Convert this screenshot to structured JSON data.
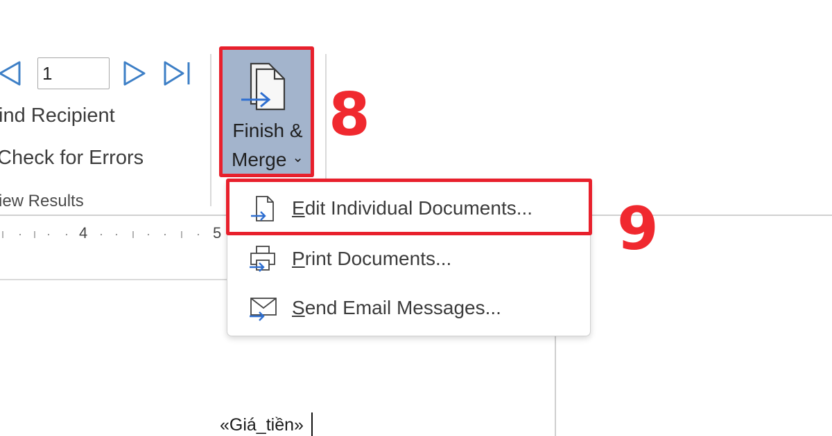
{
  "ribbon": {
    "record_number": "1",
    "find_recipient": "ind Recipient",
    "check_for_errors": "Check for Errors",
    "group_label": "iew Results"
  },
  "finish_merge": {
    "label_line1": "Finish &",
    "label_line2": "Merge ",
    "chevron": "⌄"
  },
  "annotations": {
    "step_8": "8",
    "step_9": "9",
    "highlight_color": "#e8202c"
  },
  "ruler": {
    "tick_4": "4",
    "tick_5": "5"
  },
  "dropdown": {
    "items": [
      {
        "label": "Edit Individual Documents...",
        "mnemonic": "E",
        "rest": "dit Individual Documents...",
        "icon": "edit-documents-icon"
      },
      {
        "label": "Print Documents...",
        "mnemonic": "P",
        "rest": "rint Documents...",
        "icon": "print-documents-icon"
      },
      {
        "label": "Send Email Messages...",
        "mnemonic": "S",
        "rest": "end Email Messages...",
        "icon": "email-messages-icon"
      }
    ]
  },
  "document": {
    "merge_field": "«Giá_tiền»"
  },
  "colors": {
    "button_selected": "#a3b4cc",
    "icon_blue": "#3d7fc6"
  }
}
